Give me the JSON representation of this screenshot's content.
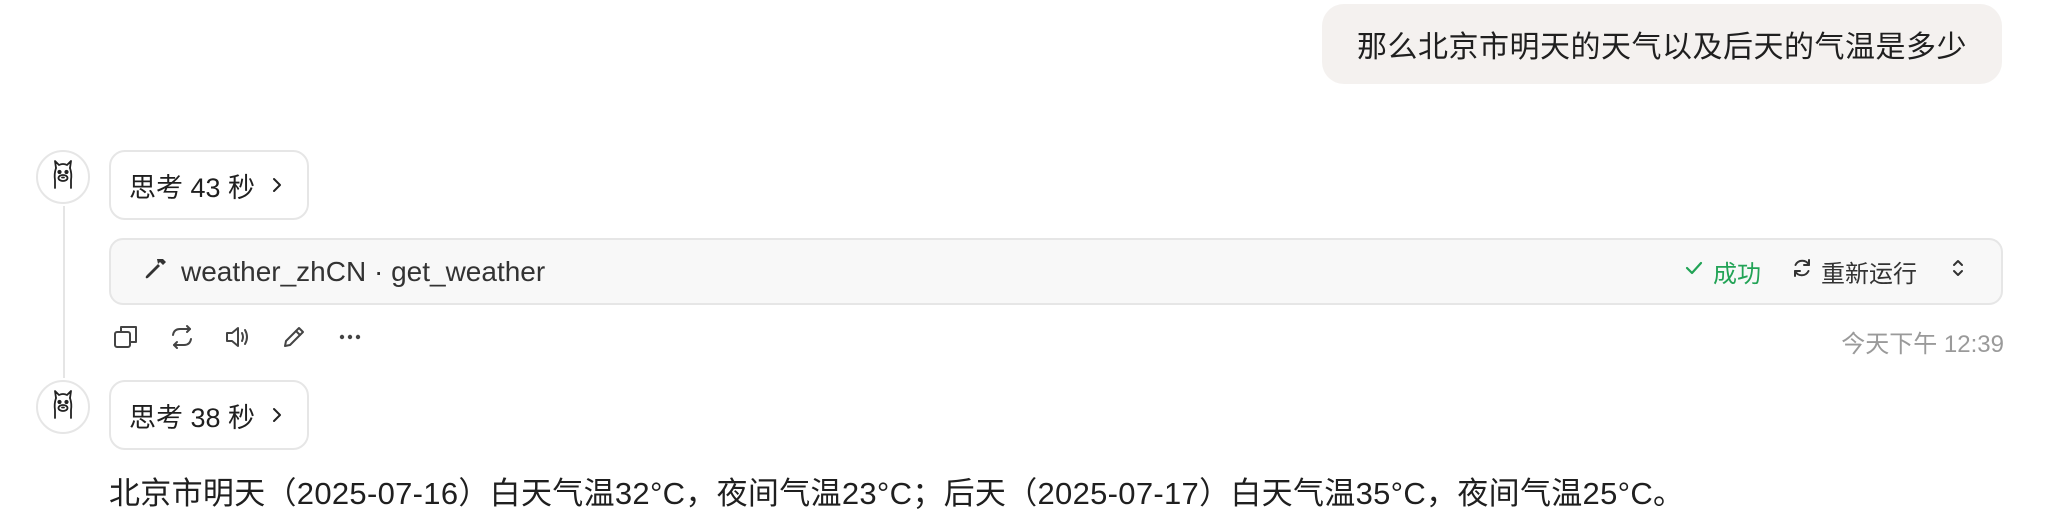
{
  "user_message": "那么北京市明天的天气以及后天的气温是多少",
  "assistant_turn_1": {
    "avatar_icon": "llama-icon",
    "thinking_label": "思考 43 秒",
    "tool_call": {
      "name": "weather_zhCN · get_weather",
      "icon": "hammer-icon",
      "status": "成功",
      "status_color": "#22a356",
      "rerun_label": "重新运行"
    },
    "actions": [
      "copy-icon",
      "regenerate-icon",
      "read-aloud-icon",
      "edit-icon",
      "more-icon"
    ],
    "timestamp": "今天下午 12:39"
  },
  "assistant_turn_2": {
    "avatar_icon": "llama-icon",
    "thinking_label": "思考 38 秒",
    "answer_text": "北京市明天（2025-07-16）白天气温32°C，夜间气温23°C；后天（2025-07-17）白天气温35°C，夜间气温25°C。"
  }
}
